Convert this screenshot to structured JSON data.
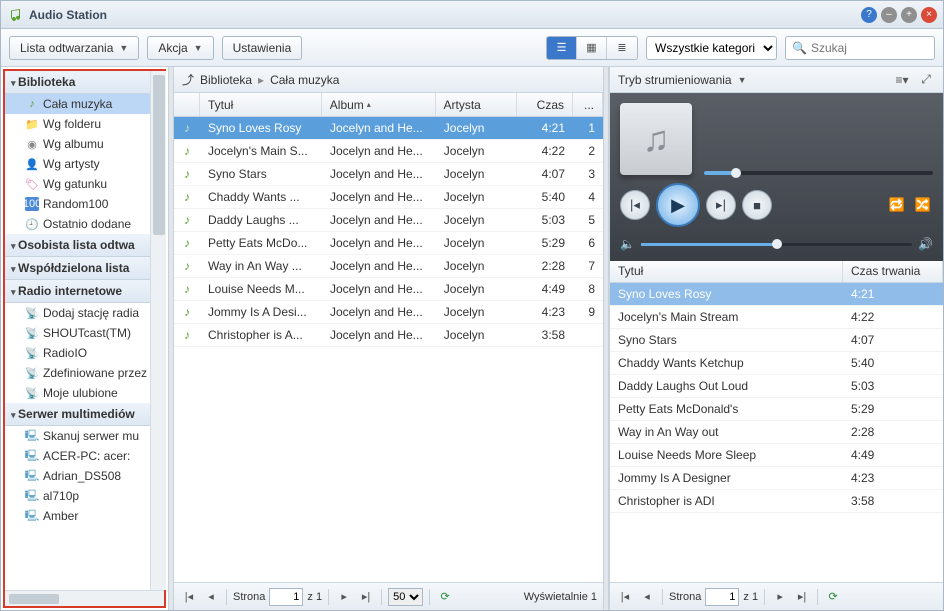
{
  "app": {
    "title": "Audio Station"
  },
  "toolbar": {
    "playlist_label": "Lista odtwarzania",
    "action_label": "Akcja",
    "settings_label": "Ustawienia",
    "category_select": "Wszystkie kategori",
    "search_placeholder": "Szukaj"
  },
  "sidebar": {
    "groups": [
      {
        "label": "Biblioteka",
        "items": [
          {
            "label": "Cała muzyka",
            "icon": "music",
            "selected": true
          },
          {
            "label": "Wg folderu",
            "icon": "folder"
          },
          {
            "label": "Wg albumu",
            "icon": "disc"
          },
          {
            "label": "Wg artysty",
            "icon": "person"
          },
          {
            "label": "Wg gatunku",
            "icon": "tag"
          },
          {
            "label": "Random100",
            "icon": "hundred"
          },
          {
            "label": "Ostatnio dodane",
            "icon": "clock"
          }
        ]
      },
      {
        "label": "Osobista lista odtwa"
      },
      {
        "label": "Współdzielona lista"
      },
      {
        "label": "Radio internetowe",
        "items": [
          {
            "label": "Dodaj stację radia",
            "icon": "radio"
          },
          {
            "label": "SHOUTcast(TM)",
            "icon": "radio"
          },
          {
            "label": "RadioIO",
            "icon": "radio"
          },
          {
            "label": "Zdefiniowane przez",
            "icon": "radio"
          },
          {
            "label": "Moje ulubione",
            "icon": "radio"
          }
        ]
      },
      {
        "label": "Serwer multimediów",
        "items": [
          {
            "label": "Skanuj serwer mu",
            "icon": "server"
          },
          {
            "label": "ACER-PC: acer:",
            "icon": "server"
          },
          {
            "label": "Adrian_DS508",
            "icon": "server"
          },
          {
            "label": "al710p",
            "icon": "server"
          },
          {
            "label": "Amber",
            "icon": "server"
          }
        ]
      }
    ]
  },
  "breadcrumb": {
    "root": "Biblioteka",
    "current": "Cała muzyka"
  },
  "columns": {
    "title": "Tytuł",
    "album": "Album",
    "artist": "Artysta",
    "duration": "Czas",
    "extra": "..."
  },
  "chart_data": {
    "type": "table",
    "columns": [
      "Tytuł",
      "Album",
      "Artysta",
      "Czas",
      "#"
    ],
    "rows": [
      [
        "Syno Loves Rosy",
        "Jocelyn and He...",
        "Jocelyn",
        "4:21",
        1
      ],
      [
        "Jocelyn's Main S...",
        "Jocelyn and He...",
        "Jocelyn",
        "4:22",
        2
      ],
      [
        "Syno Stars",
        "Jocelyn and He...",
        "Jocelyn",
        "4:07",
        3
      ],
      [
        "Chaddy Wants ...",
        "Jocelyn and He...",
        "Jocelyn",
        "5:40",
        4
      ],
      [
        "Daddy Laughs ...",
        "Jocelyn and He...",
        "Jocelyn",
        "5:03",
        5
      ],
      [
        "Petty Eats McDo...",
        "Jocelyn and He...",
        "Jocelyn",
        "5:29",
        6
      ],
      [
        "Way in An Way ...",
        "Jocelyn and He...",
        "Jocelyn",
        "2:28",
        7
      ],
      [
        "Louise Needs M...",
        "Jocelyn and He...",
        "Jocelyn",
        "4:49",
        8
      ],
      [
        "Jommy Is A Desi...",
        "Jocelyn and He...",
        "Jocelyn",
        "4:23",
        9
      ],
      [
        "Christopher is A...",
        "Jocelyn and He...",
        "Jocelyn",
        "3:58",
        ""
      ]
    ]
  },
  "tracks": [
    {
      "title": "Syno Loves Rosy",
      "album": "Jocelyn and He...",
      "artist": "Jocelyn",
      "dur": "4:21",
      "n": "1",
      "sel": true
    },
    {
      "title": "Jocelyn's Main S...",
      "album": "Jocelyn and He...",
      "artist": "Jocelyn",
      "dur": "4:22",
      "n": "2"
    },
    {
      "title": "Syno Stars",
      "album": "Jocelyn and He...",
      "artist": "Jocelyn",
      "dur": "4:07",
      "n": "3"
    },
    {
      "title": "Chaddy Wants ...",
      "album": "Jocelyn and He...",
      "artist": "Jocelyn",
      "dur": "5:40",
      "n": "4"
    },
    {
      "title": "Daddy Laughs ...",
      "album": "Jocelyn and He...",
      "artist": "Jocelyn",
      "dur": "5:03",
      "n": "5"
    },
    {
      "title": "Petty Eats McDo...",
      "album": "Jocelyn and He...",
      "artist": "Jocelyn",
      "dur": "5:29",
      "n": "6"
    },
    {
      "title": "Way in An Way ...",
      "album": "Jocelyn and He...",
      "artist": "Jocelyn",
      "dur": "2:28",
      "n": "7"
    },
    {
      "title": "Louise Needs M...",
      "album": "Jocelyn and He...",
      "artist": "Jocelyn",
      "dur": "4:49",
      "n": "8"
    },
    {
      "title": "Jommy Is A Desi...",
      "album": "Jocelyn and He...",
      "artist": "Jocelyn",
      "dur": "4:23",
      "n": "9"
    },
    {
      "title": "Christopher is A...",
      "album": "Jocelyn and He...",
      "artist": "Jocelyn",
      "dur": "3:58",
      "n": ""
    }
  ],
  "pager": {
    "page_label": "Strona",
    "page": "1",
    "of_label": "z 1",
    "perpage": "50",
    "status": "Wyświetalnie 1"
  },
  "right": {
    "mode_label": "Tryb strumieniowania"
  },
  "queue_cols": {
    "title": "Tytuł",
    "dur": "Czas trwania"
  },
  "queue": [
    {
      "title": "Syno Loves Rosy",
      "dur": "4:21",
      "sel": true
    },
    {
      "title": "Jocelyn's Main Stream",
      "dur": "4:22"
    },
    {
      "title": "Syno Stars",
      "dur": "4:07"
    },
    {
      "title": "Chaddy Wants Ketchup",
      "dur": "5:40"
    },
    {
      "title": "Daddy Laughs Out Loud",
      "dur": "5:03"
    },
    {
      "title": "Petty Eats McDonald's",
      "dur": "5:29"
    },
    {
      "title": "Way in An Way out",
      "dur": "2:28"
    },
    {
      "title": "Louise Needs More Sleep",
      "dur": "4:49"
    },
    {
      "title": "Jommy Is A Designer",
      "dur": "4:23"
    },
    {
      "title": "Christopher is ADI",
      "dur": "3:58"
    }
  ]
}
